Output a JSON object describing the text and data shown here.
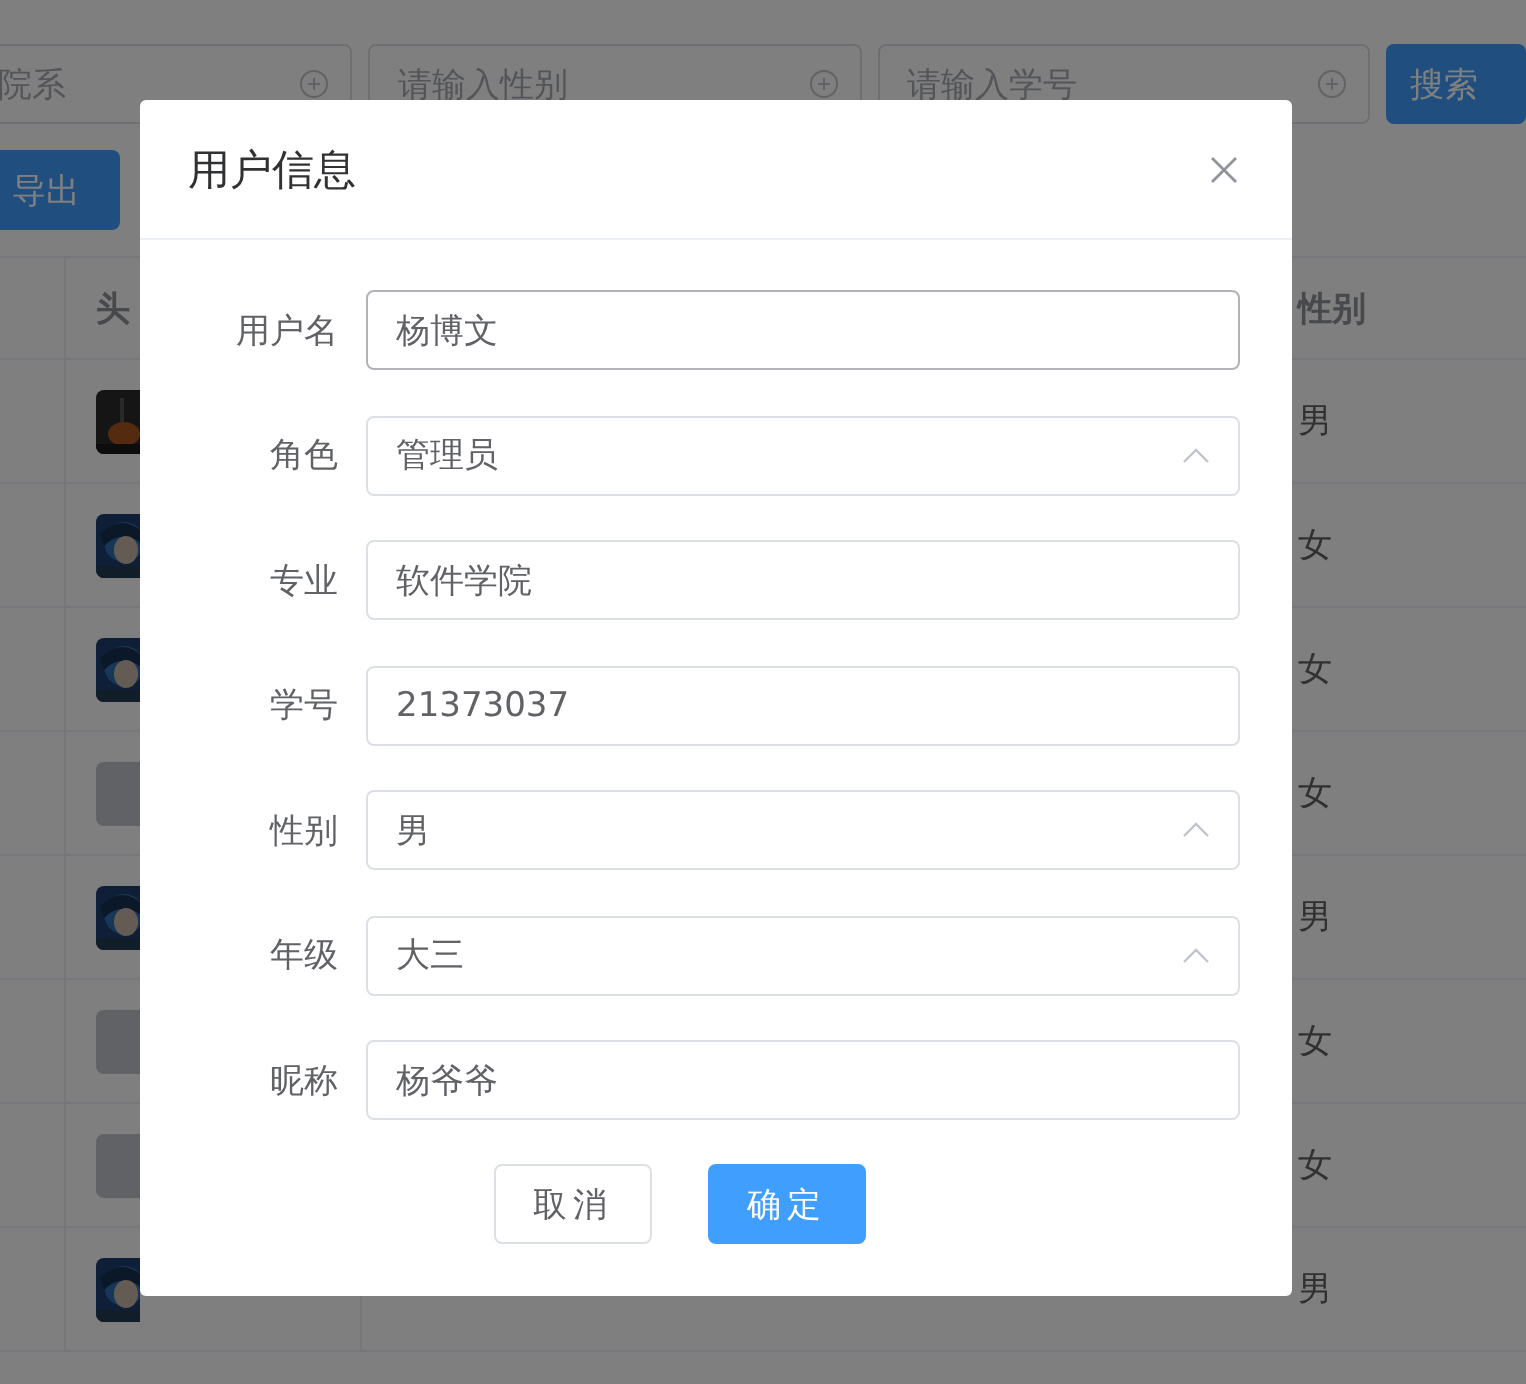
{
  "filters": [
    {
      "placeholder": "院系"
    },
    {
      "placeholder": "请输入性别"
    },
    {
      "placeholder": "请输入学号"
    }
  ],
  "search_button": "搜索",
  "export_button": "导出",
  "table": {
    "columns": [
      "头",
      "性别"
    ],
    "rows": [
      {
        "kind": "dark",
        "gender": "男"
      },
      {
        "kind": "picture",
        "gender": "女"
      },
      {
        "kind": "picture",
        "gender": "女"
      },
      {
        "kind": "empty",
        "gender": "女"
      },
      {
        "kind": "picture",
        "gender": "男"
      },
      {
        "kind": "empty",
        "gender": "女"
      },
      {
        "kind": "empty",
        "gender": "女"
      },
      {
        "kind": "picture",
        "gender": "男"
      }
    ]
  },
  "dialog": {
    "title": "用户信息",
    "fields": [
      {
        "label": "用户名",
        "kind": "input",
        "value": "杨博文",
        "focused": true
      },
      {
        "label": "角色",
        "kind": "select",
        "value": "管理员",
        "focused": false
      },
      {
        "label": "专业",
        "kind": "input",
        "value": "软件学院",
        "focused": false
      },
      {
        "label": "学号",
        "kind": "input",
        "value": "21373037",
        "focused": false
      },
      {
        "label": "性别",
        "kind": "select",
        "value": "男",
        "focused": false
      },
      {
        "label": "年级",
        "kind": "select",
        "value": "大三",
        "focused": false
      },
      {
        "label": "昵称",
        "kind": "input",
        "value": "杨爷爷",
        "focused": false
      }
    ],
    "cancel_button": "取消",
    "confirm_button": "确定"
  }
}
